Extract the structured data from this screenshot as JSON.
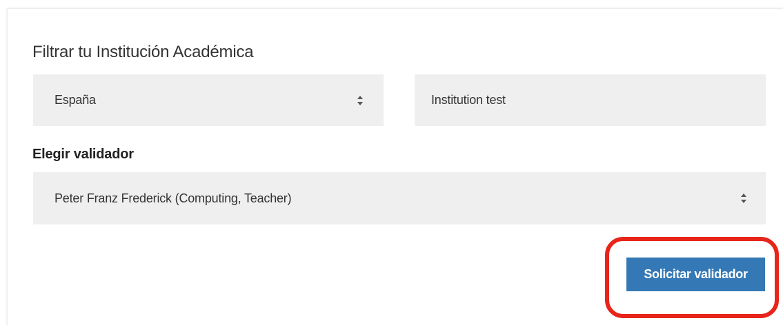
{
  "filter": {
    "title": "Filtrar tu Institución Académica",
    "country_select": {
      "value": "España",
      "icon": "select-arrows-icon"
    },
    "institution_input": {
      "value": "Institution test"
    }
  },
  "validator": {
    "label": "Elegir validador",
    "select": {
      "value": "Peter Franz Frederick (Computing, Teacher)",
      "icon": "select-arrows-icon"
    }
  },
  "actions": {
    "request_label": "Solicitar validador",
    "button_color": "#3478b5",
    "highlight_color": "#e8251a"
  }
}
